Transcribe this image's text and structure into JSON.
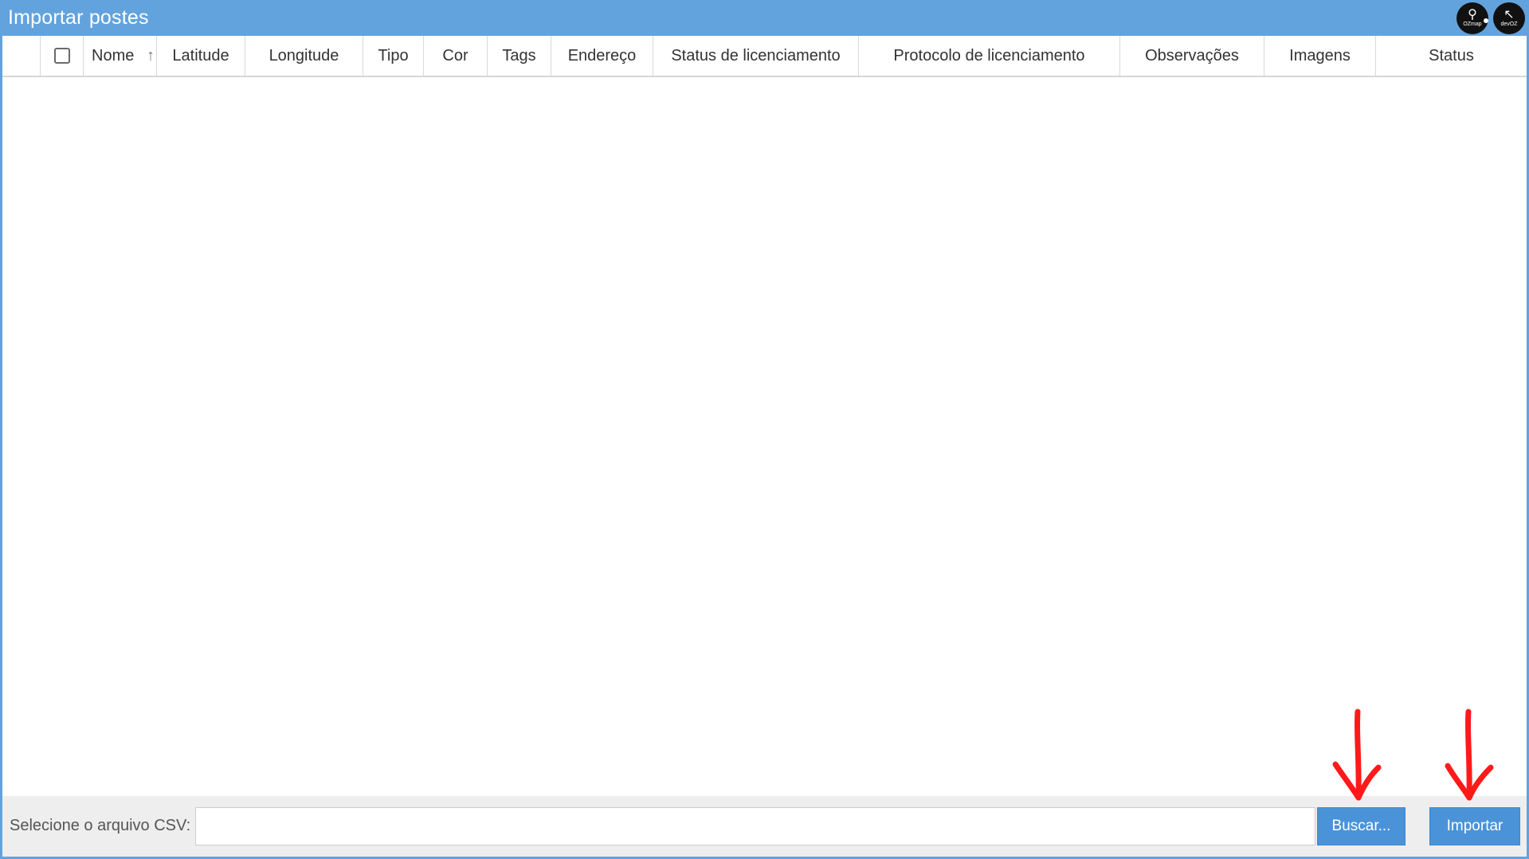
{
  "window": {
    "title": "Importar postes"
  },
  "logos": {
    "left_label": "OZmap",
    "right_label": "devOZ"
  },
  "table": {
    "columns": [
      "Nome",
      "Latitude",
      "Longitude",
      "Tipo",
      "Cor",
      "Tags",
      "Endereço",
      "Status de licenciamento",
      "Protocolo de licenciamento",
      "Observações",
      "Imagens",
      "Status"
    ],
    "rows": [],
    "sort": {
      "column": "Nome",
      "direction": "asc"
    }
  },
  "footer": {
    "label": "Selecione o arquivo CSV:",
    "file_value": "",
    "buscar_label": "Buscar...",
    "importar_label": "Importar"
  },
  "colors": {
    "titlebar": "#62a3de",
    "button": "#4b93d8",
    "annotation_arrow": "#ff1a1a"
  },
  "icons": {
    "sort": "arrow-up-icon",
    "annotation": "red-arrow-down-icon"
  }
}
